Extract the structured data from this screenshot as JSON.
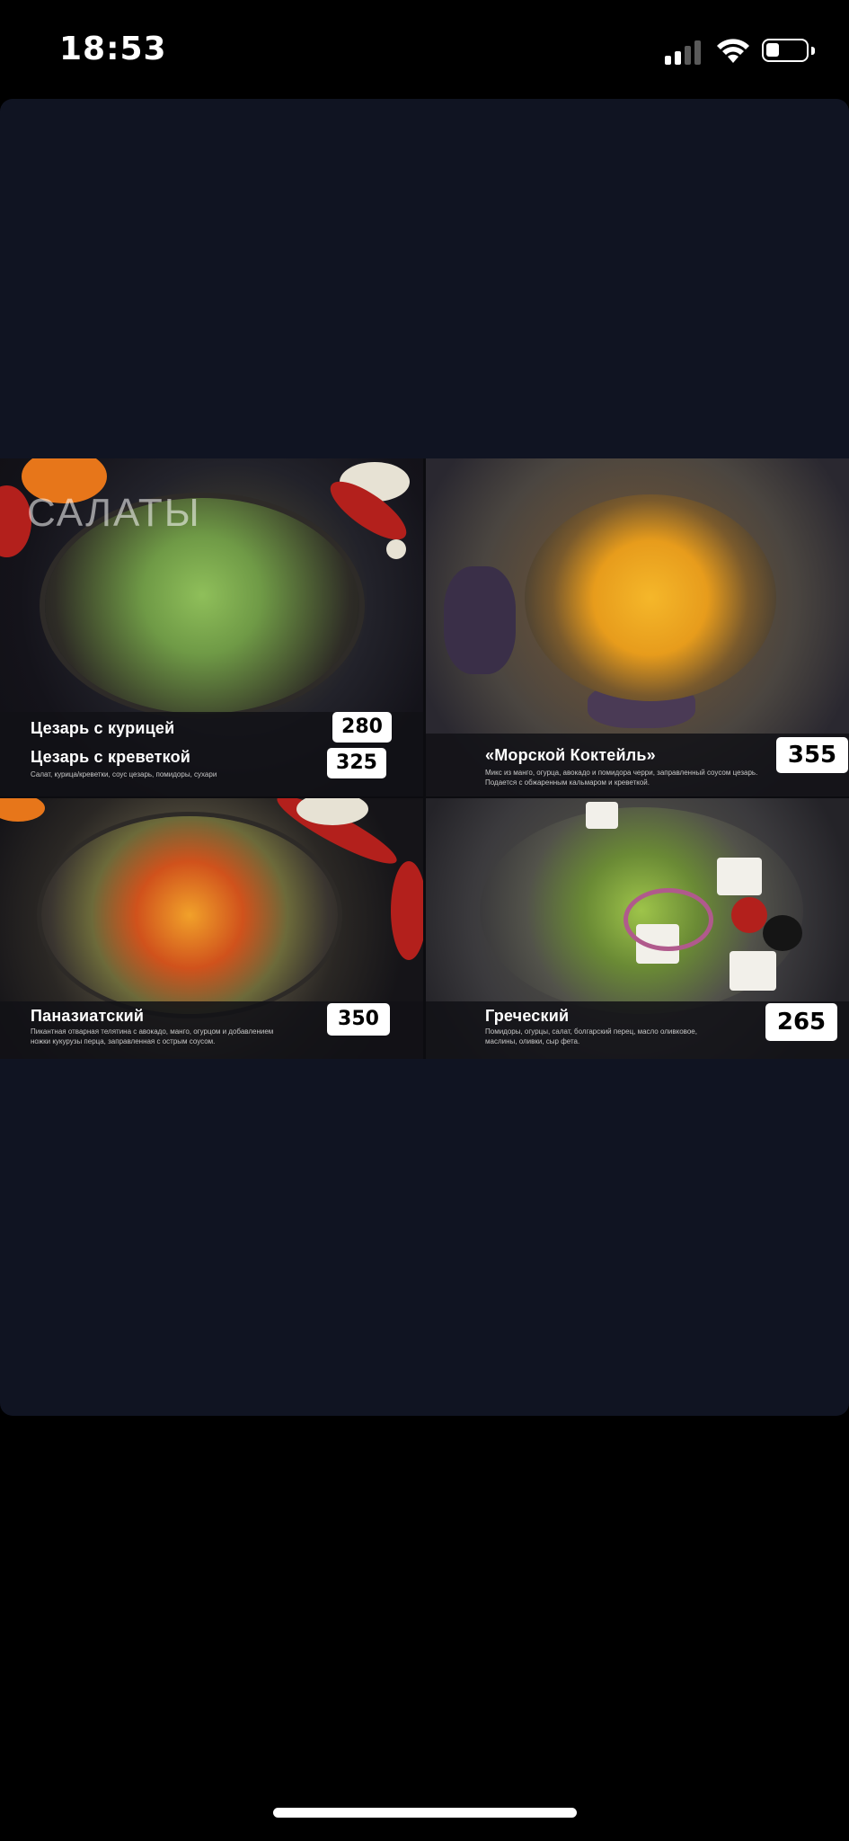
{
  "status_bar": {
    "time": "18:53"
  },
  "menu": {
    "section_title": "САЛАТЫ",
    "dishes": [
      {
        "name": "Цезарь с курицей",
        "price": "280"
      },
      {
        "name": "Цезарь с креветкой",
        "price": "325",
        "description": "Салат, курица/креветки, соус цезарь, помидоры, сухари"
      },
      {
        "name": "«Морской Коктейль»",
        "price": "355",
        "description_line1": "Микс из манго, огурца, авокадо и помидора черри, заправленный соусом цезарь.",
        "description_line2": "Подается с обжаренным кальмаром и креветкой."
      },
      {
        "name": "Паназиатский",
        "price": "350",
        "description_line1": "Пикантная отварная телятина с авокадо, манго, огурцом и добавлением",
        "description_line2": "ножки кукурузы перца, заправленная с острым соусом."
      },
      {
        "name": "Греческий",
        "price": "265",
        "description_line1": "Помидоры, огурцы, салат, болгарский перец, масло оливковое,",
        "description_line2": "маслины, оливки, сыр фета."
      }
    ]
  },
  "icons": {
    "signal": "cellular-signal-icon",
    "wifi": "wifi-icon",
    "battery": "battery-icon"
  },
  "colors": {
    "background": "#000000",
    "viewer_background": "#101422",
    "price_badge": "#ffffff"
  }
}
